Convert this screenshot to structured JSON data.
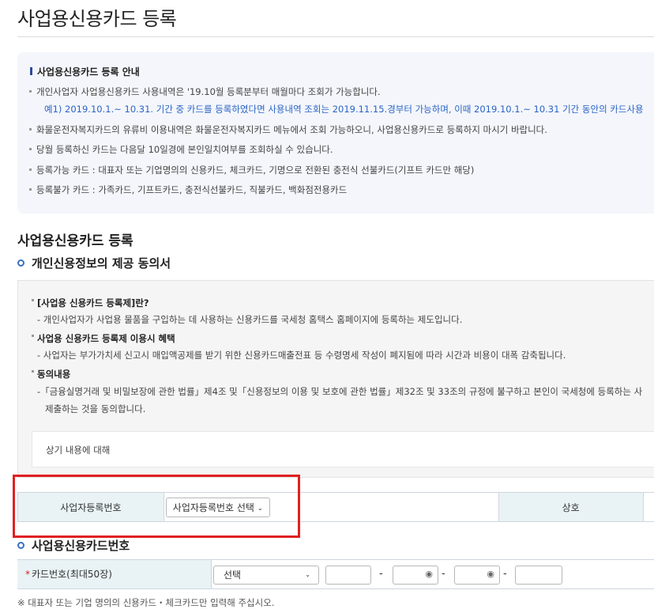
{
  "page": {
    "title": "사업용신용카드 등록"
  },
  "guide": {
    "heading": "사업용신용카드 등록 안내",
    "line1": "개인사업자 사업용신용카드 사용내역은 '19.10월 등록분부터 매월마다 조회가 가능합니다.",
    "line1_example": "예1) 2019.10.1.~ 10.31. 기간 중 카드를 등록하였다면 사용내역 조회는 2019.11.15.경부터 가능하며, 이때 2019.10.1.~ 10.31 기간 동안의 카드사용",
    "line2": "화물운전자복지카드의 유류비 이용내역은 화물운전자복지카드 메뉴에서 조회 가능하오니, 사업용신용카드로 등록하지 마시기 바랍니다.",
    "line3": "당월 등록하신 카드는 다음달 10일경에 본인일치여부를 조회하실 수 있습니다.",
    "line4": "등록가능 카드 : 대표자 또는 기업명의의 신용카드, 체크카드, 기명으로 전환된 충전식 선불카드(기프트 카드만 해당)",
    "line5": "등록불가 카드 : 가족카드, 기프트카드, 충전식선불카드, 직불카드, 백화점전용카드"
  },
  "register": {
    "section_title": "사업용신용카드 등록"
  },
  "consent": {
    "title": "개인신용정보의 제공 동의서",
    "h1": "[사업용 신용카드 등록제]란?",
    "t1": "- 개인사업자가 사업용 물품을 구입하는 데 사용하는 신용카드를 국세청 홈택스 홈페이지에 등록하는 제도입니다.",
    "h2": "사업용 신용카드 등록제 이용시 혜택",
    "t2": "- 사업자는 부가가치세 신고시 매입액공제를 받기 위한 신용카드매출전표 등 수령명세 작성이 폐지됨에 따라 시간과 비용이 대폭 감축됩니다.",
    "h3": "동의내용",
    "t3a": "-「금융실명거래 및 비밀보장에 관한 법률」제4조 및「신용정보의 이용 및 보호에 관한 법률」제32조 및 33조의 규정에 불구하고 본인이 국세청에 등록하는 사",
    "t3b": "제출하는 것을 동의합니다.",
    "agree_text": "상기 내용에 대해"
  },
  "business_row": {
    "label": "사업자등록번호",
    "select_value": "사업자등록번호 선택",
    "company_label": "상호"
  },
  "card": {
    "title": "사업용신용카드번호",
    "label_required": "*",
    "label": "카드번호(최대50장)",
    "select_value": "선택",
    "dash": "-"
  },
  "notice": "※ 대표자 또는 기업 명의의 신용카드・체크카드만 입력해 주십시오.",
  "colors": {
    "accent": "#2b4a9b",
    "link_blue": "#2a64c5",
    "header_cell": "#e9f3f5",
    "highlight": "#e02020"
  }
}
